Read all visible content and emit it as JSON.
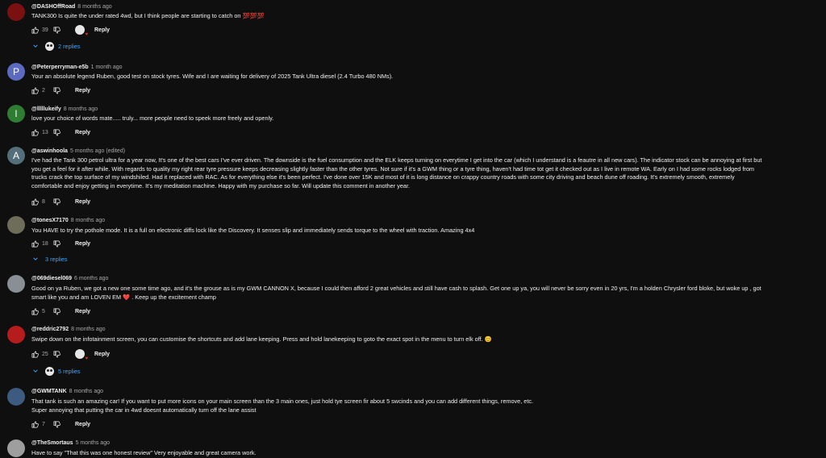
{
  "comments": [
    {
      "author": "@DASHOffRoad",
      "time": "8 months ago",
      "text": [
        "TANK300 Is quite the under rated 4wd, but I think people are starting to catch on 💯💯💯"
      ],
      "likes": "39",
      "reply": "Reply",
      "creator_heart": true,
      "replies": "2 replies",
      "avatar_letter": "",
      "avatar_color": "#7a1010"
    },
    {
      "author": "@Peterperryman-e5b",
      "time": "1 month ago",
      "text": [
        "Your an absolute legend Ruben, good test on stock tyres. Wife and I are waiting for delivery of 2025 Tank Ultra diesel (2.4 Turbo 480 NMs)."
      ],
      "likes": "2",
      "reply": "Reply",
      "creator_heart": false,
      "replies": "",
      "avatar_letter": "P",
      "avatar_color": "#5c6bc0"
    },
    {
      "author": "@lllllukeify",
      "time": "8 months ago",
      "text": [
        "love your choice of words mate..... truly... more people need to speek more freely and openly."
      ],
      "likes": "13",
      "reply": "Reply",
      "creator_heart": false,
      "replies": "",
      "avatar_letter": "l",
      "avatar_color": "#2e7d32"
    },
    {
      "author": "@aswinhoola",
      "time": "5 months ago (edited)",
      "text": [
        "I've had the Tank 300 petrol ultra for a year now, It's one of the best cars I've ever driven. The downside is the fuel consumption and the ELK keeps turning on everytime I get into the car (which I understand is a feautre in all new cars). The indicator stock can be annoying at first but",
        "you get a feel for it after while. With regards to quality my right rear tyre pressure keeps decreasing slightly faster than the other tyres. Not sure if it's a GWM thing or a tyre thing, haven't had time tot get it checked out as I live in remote WA. Early on I had some rocks lodged from",
        "trucks crack the top surface of my windshiled. Had it replaced with RAC. As for everything else it's been perfect. I've done over 15K and most of it is long distance on crappy country roads with some city driving and beach dune off roading. It's extremely smooth, extremely",
        "comfortable and enjoy getting in everytime. It's my meditation machine. Happy with my purchase so far. Will update this comment in another year."
      ],
      "likes": "8",
      "reply": "Reply",
      "creator_heart": false,
      "replies": "",
      "avatar_letter": "A",
      "avatar_color": "#546e7a"
    },
    {
      "author": "@tonesX7170",
      "time": "8 months ago",
      "text": [
        "You HAVE to try the pothole mode. It is a full on electronic diffs lock like the Discovery. It senses slip and immediately sends torque to the wheel with traction. Amazing 4x4"
      ],
      "likes": "18",
      "reply": "Reply",
      "creator_heart": false,
      "replies": "3 replies",
      "avatar_letter": "",
      "avatar_color": "#6d6d5a"
    },
    {
      "author": "@069diesel069",
      "time": "6 months ago",
      "text": [
        "Good on ya Ruben, we got a new one some time ago, and it's the grouse as is my GWM CANNON X, because I could then afford 2  great vehicles and still have cash to splash. Get one up ya, you will never be sorry even in 20 yrs, I'm a holden Chrysler ford bloke, but woke up , got",
        "smart like you and am LOVEN EM ❤️ . Keep up the excitement champ"
      ],
      "likes": "5",
      "reply": "Reply",
      "creator_heart": false,
      "replies": "",
      "avatar_letter": "",
      "avatar_color": "#8a8f96"
    },
    {
      "author": "@reddric2792",
      "time": "8 months ago",
      "text": [
        "Swipe down on the infotainment screen, you can customise the shortcuts and add lane keeping. Press and hold lanekeeping to goto the exact spot in the menu to turn elk off. 😊"
      ],
      "likes": "25",
      "reply": "Reply",
      "creator_heart": true,
      "replies": "5 replies",
      "avatar_letter": "",
      "avatar_color": "#b71c1c"
    },
    {
      "author": "@GWMTANK",
      "time": "8 months ago",
      "text": [
        "That tank is such an amazing car! If you want to put more icons on your main screen than the 3 main ones, just hold tye screen fir about 5 swcinds and you can add different things, remove, etc.",
        "Super annoying that putting the car in 4wd doesnt automatically turn off the lane assist"
      ],
      "likes": "7",
      "reply": "Reply",
      "creator_heart": false,
      "replies": "",
      "avatar_letter": "",
      "avatar_color": "#3d5a80"
    },
    {
      "author": "@TheSmortaus",
      "time": "5 months ago",
      "text": [
        "Have to say \"That this was one honest review\" Very enjoyable and great camera work."
      ],
      "likes": "",
      "reply": "",
      "creator_heart": false,
      "replies": "",
      "avatar_letter": "",
      "avatar_color": "#9e9e9e"
    }
  ]
}
